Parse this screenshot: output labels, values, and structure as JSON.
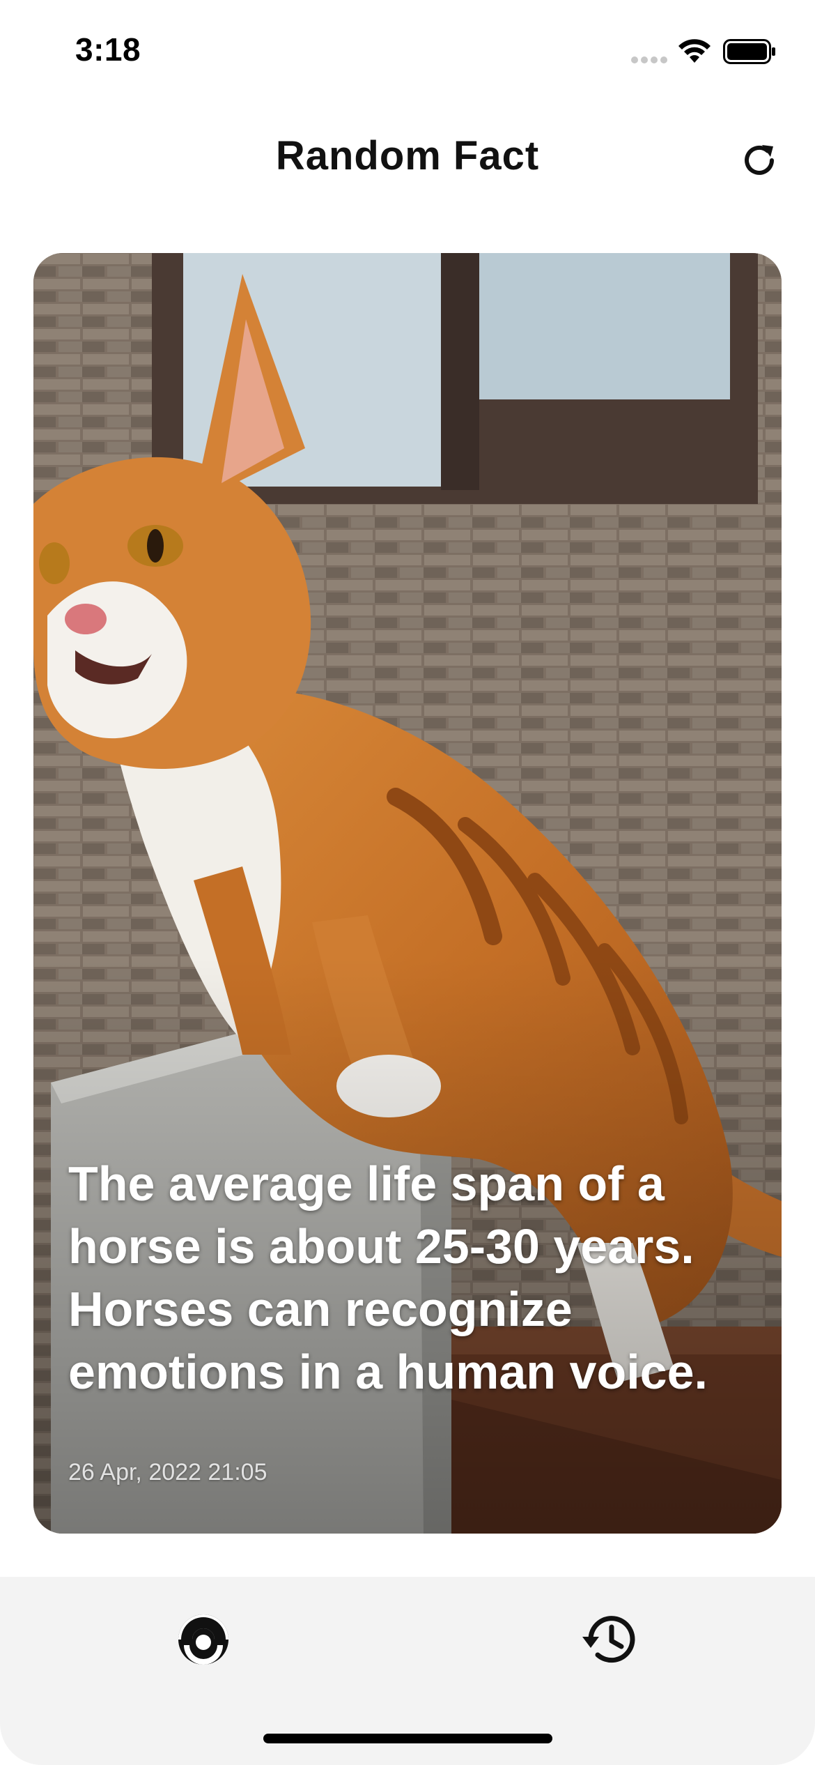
{
  "status_bar": {
    "time": "3:18",
    "icons": [
      "cellular-signal-icon",
      "wifi-icon",
      "battery-icon"
    ]
  },
  "nav": {
    "title": "Random Fact",
    "refresh_icon": "refresh-icon"
  },
  "fact": {
    "text": "The average life span of a horse is about 25-30 years. Horses can recognize emotions in a human voice.",
    "date": "26 Apr, 2022 21:05",
    "image": "ginger-cat-on-fence-photo"
  },
  "tab_bar": {
    "tabs": [
      {
        "icon": "random-fact-tab-icon",
        "selected": true
      },
      {
        "icon": "history-icon",
        "selected": false
      }
    ]
  },
  "colors": {
    "background": "#ffffff",
    "tab_bar_background": "#f3f3f3",
    "text_primary": "#111111",
    "fact_text": "#ffffff"
  }
}
